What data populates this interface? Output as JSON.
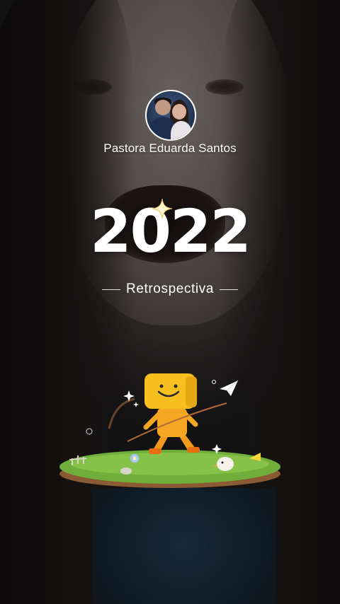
{
  "profile": {
    "name": "Pastora Eduarda Santos"
  },
  "title": {
    "year": "2022",
    "subtitle": "Retrospectiva"
  },
  "colors": {
    "text": "#ffffff",
    "mascot": "#f5a623",
    "grass": "#6fae3a"
  },
  "icons": {
    "sparkle": "sparkle-icon",
    "paper_plane": "paper-plane-icon"
  }
}
